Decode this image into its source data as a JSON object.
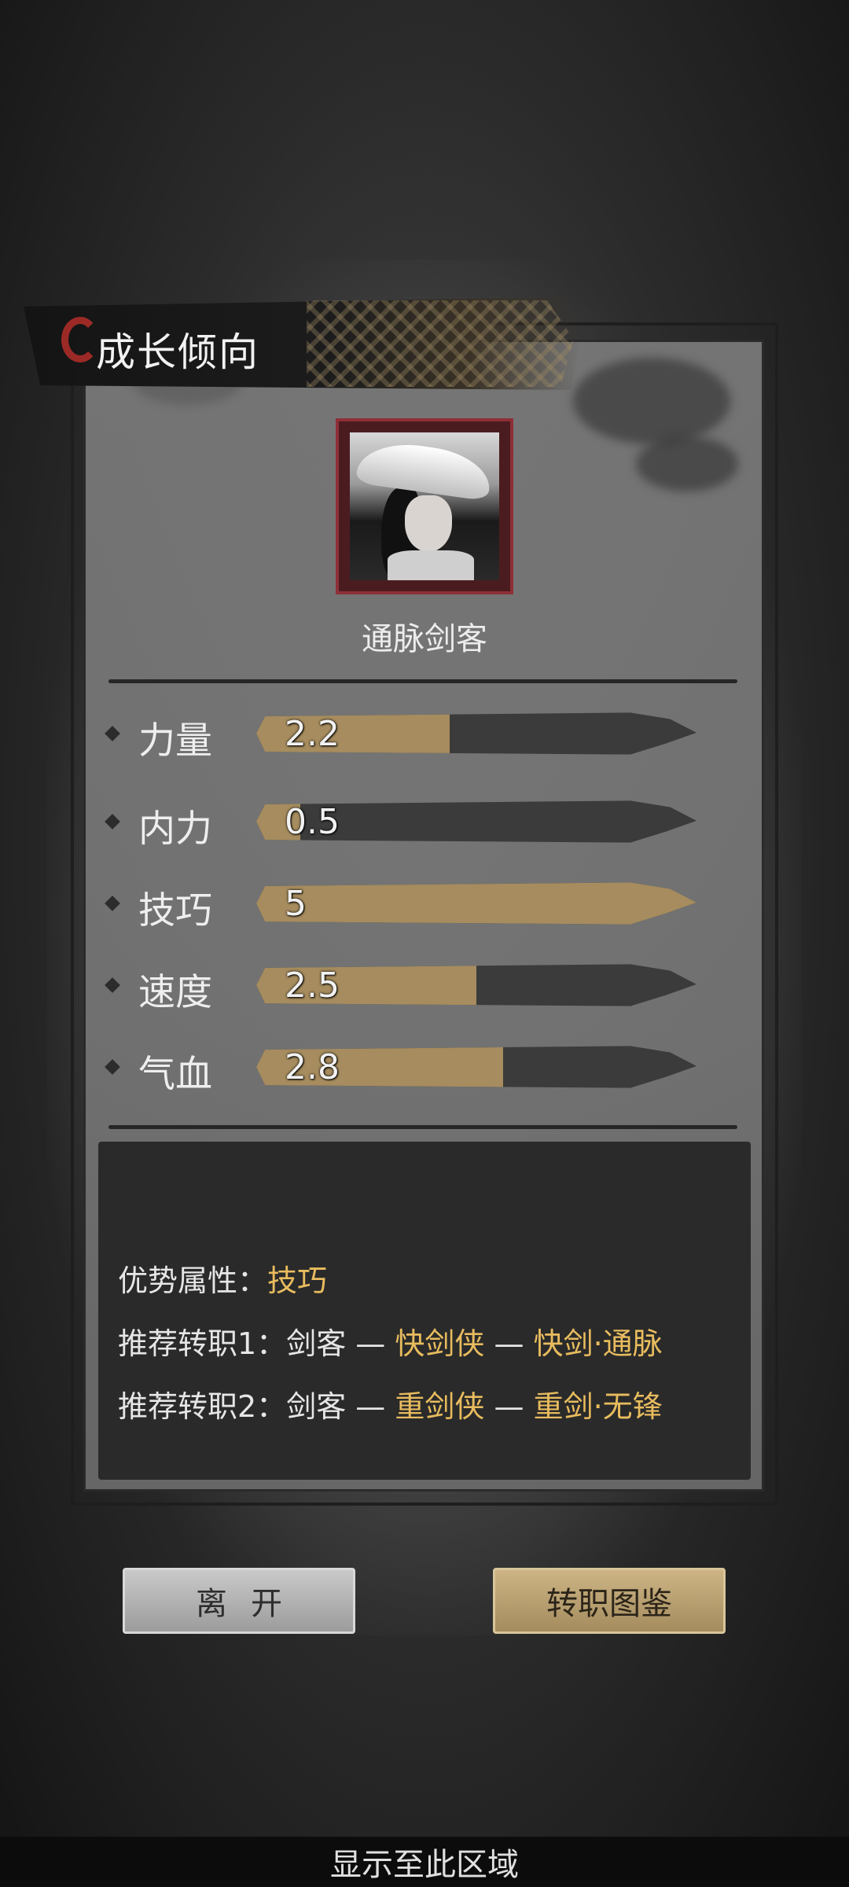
{
  "header": {
    "title": "成长倾向"
  },
  "character": {
    "portrait_icon": "swordsman-portrait",
    "class_name": "通脉剑客"
  },
  "stats": [
    {
      "label": "力量",
      "value_text": "2.2",
      "fill": 0.44
    },
    {
      "label": "内力",
      "value_text": "0.5",
      "fill": 0.1
    },
    {
      "label": "技巧",
      "value_text": "5",
      "fill": 1.0
    },
    {
      "label": "速度",
      "value_text": "2.5",
      "fill": 0.5
    },
    {
      "label": "气血",
      "value_text": "2.8",
      "fill": 0.56
    }
  ],
  "info": {
    "advantage_label": "优势属性：",
    "advantage_value": "技巧",
    "path1_label": "推荐转职1：",
    "path1_base": "剑客",
    "path1_sep": " — ",
    "path1_mid": "快剑侠",
    "path1_end": "快剑·通脉",
    "path2_label": "推荐转职2：",
    "path2_base": "剑客",
    "path2_sep": " — ",
    "path2_mid": "重剑侠",
    "path2_end": "重剑·无锋"
  },
  "buttons": {
    "leave": "离开",
    "guide": "转职图鉴"
  },
  "footer": {
    "text": "显示至此区域"
  },
  "colors": {
    "gold": "#e8bc5e",
    "bar_fill": "#a68c5e",
    "seal_red": "#9b2a26"
  }
}
